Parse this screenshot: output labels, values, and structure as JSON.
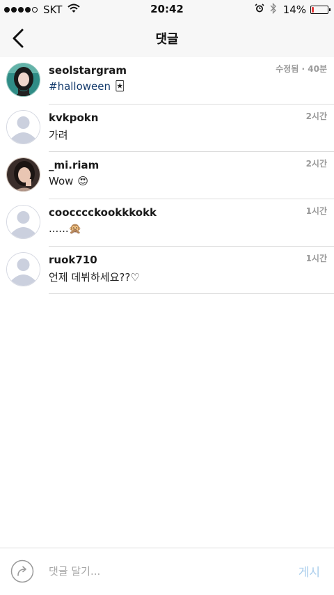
{
  "status_bar": {
    "carrier": "SKT",
    "time": "20:42",
    "battery_percent": "14%",
    "battery_level": 0.14,
    "battery_color": "#e63b3b",
    "icons": [
      "signal-dots-icon",
      "wifi-icon",
      "alarm-icon",
      "bluetooth-icon",
      "battery-icon"
    ]
  },
  "nav": {
    "title": "댓글",
    "back_icon": "chevron-left-icon"
  },
  "comments": [
    {
      "username": "seolstargram",
      "hashtag": "#halloween",
      "emoji": "🃏",
      "meta": "수정됨 · 40분",
      "avatar": "photo"
    },
    {
      "username": "kvkpokn",
      "text": "가려",
      "meta": "2시간",
      "avatar": "default-user"
    },
    {
      "username": "_mi.riam",
      "text": "Wow",
      "emoji": "😍",
      "meta": "2시간",
      "avatar": "photo"
    },
    {
      "username": "coocccckookkkokk",
      "text": "......",
      "emoji": "🙊",
      "meta": "1시간",
      "avatar": "default-user"
    },
    {
      "username": "ruok710",
      "text": "언제 데뷔하세요??♡",
      "meta": "1시간",
      "avatar": "default-user"
    }
  ],
  "composer": {
    "placeholder": "댓글 달기...",
    "value": "",
    "post_label": "게시",
    "post_color": "#a9cdec",
    "reply_icon": "reply-arrow-icon"
  }
}
